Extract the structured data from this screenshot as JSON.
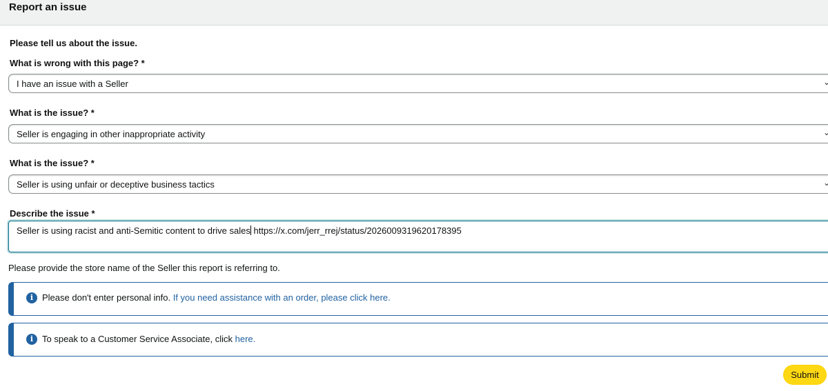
{
  "header": {
    "title": "Report an issue"
  },
  "form": {
    "intro": "Please tell us about the issue.",
    "field1": {
      "label": "What is wrong with this page? *",
      "value": "I have an issue with a Seller"
    },
    "field2": {
      "label": "What is the issue? *",
      "value": "Seller is engaging in other inappropriate activity"
    },
    "field3": {
      "label": "What is the issue? *",
      "value": "Seller is using unfair or deceptive business tactics"
    },
    "describe": {
      "label": "Describe the issue *",
      "value_before_cursor": "Seller is using racist and anti-Semitic content to drive sales",
      "value_after_cursor": " https://x.com/jerr_rrej/status/2026009319620178395"
    },
    "helper": "Please provide the store name of the Seller this report is referring to."
  },
  "alerts": [
    {
      "icon": "info-icon",
      "text": "Please don't enter personal info.",
      "link": "If you need assistance with an order, please click here."
    },
    {
      "icon": "info-icon",
      "text": "To speak to a Customer Service Associate, click",
      "link": "here."
    }
  ],
  "actions": {
    "submit_label": "Submit"
  },
  "colors": {
    "accent": "#2162a1",
    "submit": "#ffd814",
    "focus": "#007185"
  }
}
